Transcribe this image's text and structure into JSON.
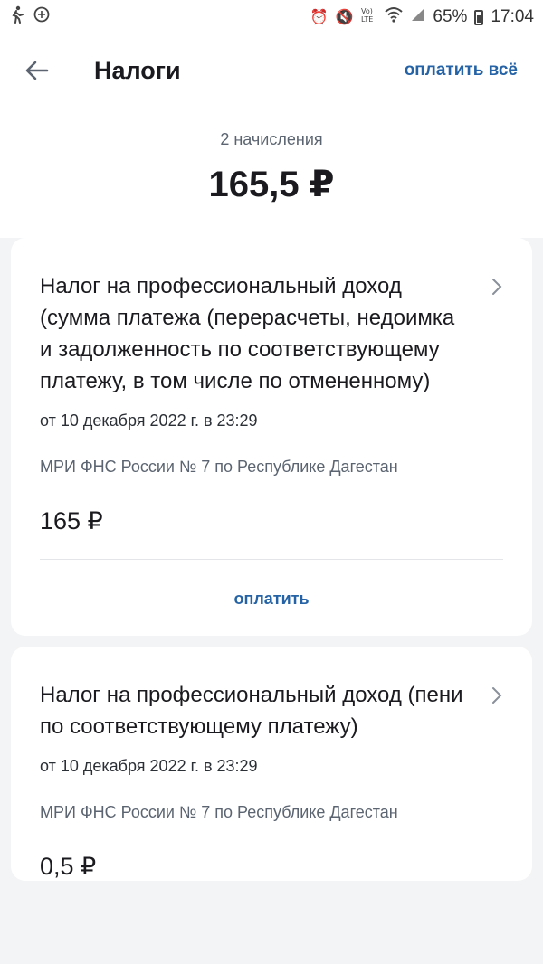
{
  "status_bar": {
    "battery": "65%",
    "time": "17:04",
    "left_icons": [
      "walk-icon",
      "data-saver-icon"
    ],
    "right_icons": [
      "alarm-icon",
      "mute-icon",
      "volte-icon",
      "wifi-icon",
      "signal-icon",
      "battery-icon"
    ]
  },
  "header": {
    "title": "Налоги",
    "pay_all": "оплатить всё"
  },
  "summary": {
    "count": "2 начисления",
    "total": "165,5 ₽"
  },
  "charges": [
    {
      "title": "Налог на профессиональный доход (сумма платежа (перерасчеты, недоимка и задолженность по соответствующему платежу, в том числе по отмененному)",
      "date": "от 10 декабря 2022 г. в 23:29",
      "org": "МРИ ФНС России № 7 по Республике Дагестан",
      "amount": "165 ₽",
      "pay": "оплатить"
    },
    {
      "title": "Налог на профессиональный доход (пени по соответствующему платежу)",
      "date": "от 10 декабря 2022 г. в 23:29",
      "org": "МРИ ФНС России № 7 по Республике Дагестан",
      "amount": "0,5 ₽"
    }
  ],
  "colors": {
    "accent": "#2563a6",
    "background": "#f3f4f6",
    "card": "#ffffff",
    "secondary_text": "#5b6470"
  }
}
